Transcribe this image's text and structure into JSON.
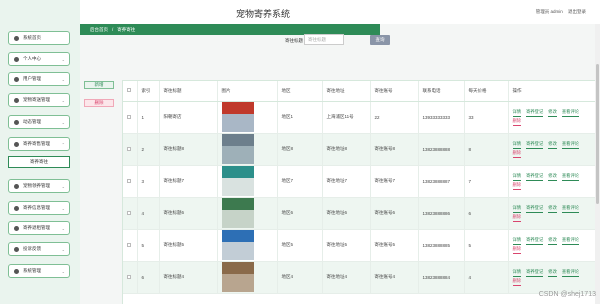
{
  "header": {
    "title": "宠物寄养系统",
    "user_label": "管理员 admin",
    "logout_label": "退出登录"
  },
  "sidebar": {
    "items": [
      {
        "label": "系统首页",
        "icon": "home-icon"
      },
      {
        "label": "个人中心",
        "icon": "user-icon"
      },
      {
        "label": "用户管理",
        "icon": "users-icon"
      },
      {
        "label": "宠物寄送管理",
        "icon": "paw-icon"
      },
      {
        "label": "动态管理",
        "icon": "news-icon"
      },
      {
        "label": "寄养寄售管理",
        "icon": "box-icon",
        "expanded": true
      },
      {
        "label": "宠物领养管理",
        "icon": "heart-icon"
      },
      {
        "label": "寄养信息管理",
        "icon": "info-icon"
      },
      {
        "label": "寄养退租管理",
        "icon": "return-icon"
      },
      {
        "label": "投诉反馈",
        "icon": "feedback-icon"
      },
      {
        "label": "系统管理",
        "icon": "gear-icon"
      }
    ],
    "sub_item": "寄养寄往"
  },
  "breadcrumb": {
    "home": "后台首页",
    "separator": "/",
    "current": "寄养寄往"
  },
  "search": {
    "label": "寄往标题",
    "placeholder": "寄往标题",
    "button": "查询"
  },
  "actions": {
    "new": "新增",
    "delete": "删除"
  },
  "table": {
    "headers": [
      "索引",
      "寄往标题",
      "图片",
      "地区",
      "寄往地址",
      "寄往账号",
      "联系电话",
      "每天价格",
      "操作"
    ],
    "rows": [
      {
        "index": "1",
        "title": "阳朝寄店",
        "region": "地区1",
        "address": "上海浦区11号",
        "account": "22",
        "phone": "13933333333",
        "price": "33"
      },
      {
        "index": "2",
        "title": "寄往标题8",
        "region": "地区8",
        "address": "寄往地址8",
        "account": "寄往账号8",
        "phone": "13823888888",
        "price": "8"
      },
      {
        "index": "3",
        "title": "寄往标题7",
        "region": "地区7",
        "address": "寄往地址7",
        "account": "寄往账号7",
        "phone": "13823888887",
        "price": "7"
      },
      {
        "index": "4",
        "title": "寄往标题6",
        "region": "地区6",
        "address": "寄往地址6",
        "account": "寄往账号6",
        "phone": "13823888886",
        "price": "6"
      },
      {
        "index": "5",
        "title": "寄往标题5",
        "region": "地区5",
        "address": "寄往地址5",
        "account": "寄往账号5",
        "phone": "13823888885",
        "price": "5"
      },
      {
        "index": "6",
        "title": "寄往标题4",
        "region": "地区4",
        "address": "寄往地址4",
        "account": "寄往账号4",
        "phone": "13823888884",
        "price": "4"
      }
    ],
    "ops": {
      "detail": "详情",
      "register": "寄养登记",
      "edit": "修改",
      "comments": "查看评论",
      "delete": "删除"
    }
  },
  "watermark": "CSDN @shej1713",
  "colors": {
    "accent": "#2e8b57",
    "danger": "#d9456e",
    "sidebar_bg": "#eaf4ee"
  }
}
